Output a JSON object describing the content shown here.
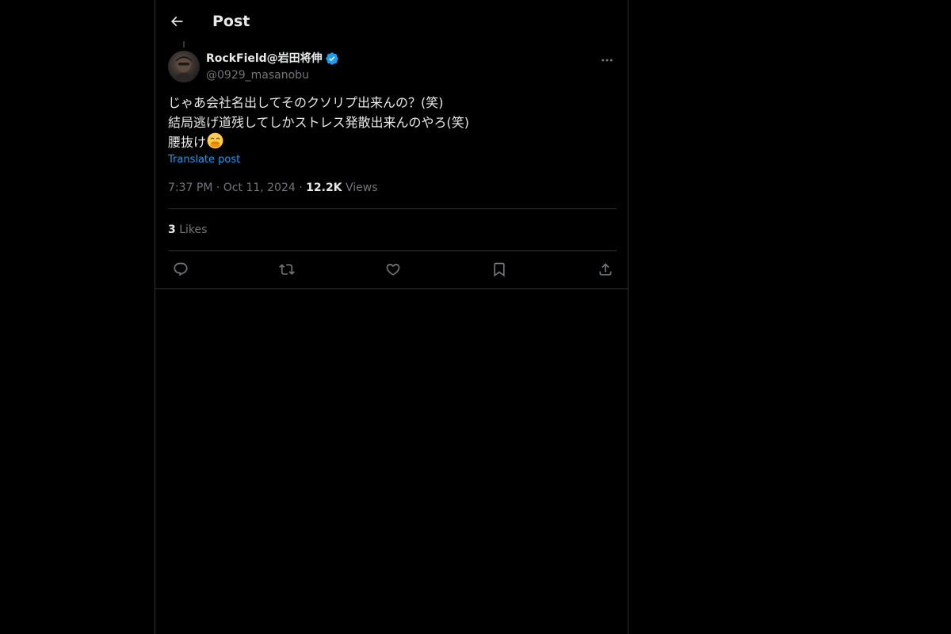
{
  "header": {
    "back_icon": "arrow-left-icon",
    "title": "Post"
  },
  "author": {
    "display_name": "RockField@岩田将伸",
    "handle": "@0929_masanobu",
    "verified": true,
    "verified_color": "#1d9bf0",
    "avatar_icon": "profile-photo"
  },
  "post": {
    "lines": [
      "じゃあ会社名出してそのクソリプ出来んの？(笑)",
      "結局逃げ道残してしかストレス発散出来んのやろ(笑)",
      "腰抜け"
    ],
    "emoji": "face-with-hand-over-mouth",
    "translate_label": "Translate post"
  },
  "meta": {
    "time": "7:37 PM",
    "separator": "·",
    "date": "Oct 11, 2024",
    "views_count": "12.2K",
    "views_label": "Views"
  },
  "stats": {
    "likes_count": "3",
    "likes_label": "Likes"
  },
  "actions": [
    {
      "name": "reply",
      "icon": "reply-icon"
    },
    {
      "name": "repost",
      "icon": "repost-icon"
    },
    {
      "name": "like",
      "icon": "heart-icon"
    },
    {
      "name": "bookmark",
      "icon": "bookmark-icon"
    },
    {
      "name": "share",
      "icon": "share-icon"
    }
  ],
  "colors": {
    "background": "#000000",
    "text_primary": "#e7e9ea",
    "text_secondary": "#71767b",
    "accent": "#1d9bf0",
    "border": "#2f3336"
  }
}
